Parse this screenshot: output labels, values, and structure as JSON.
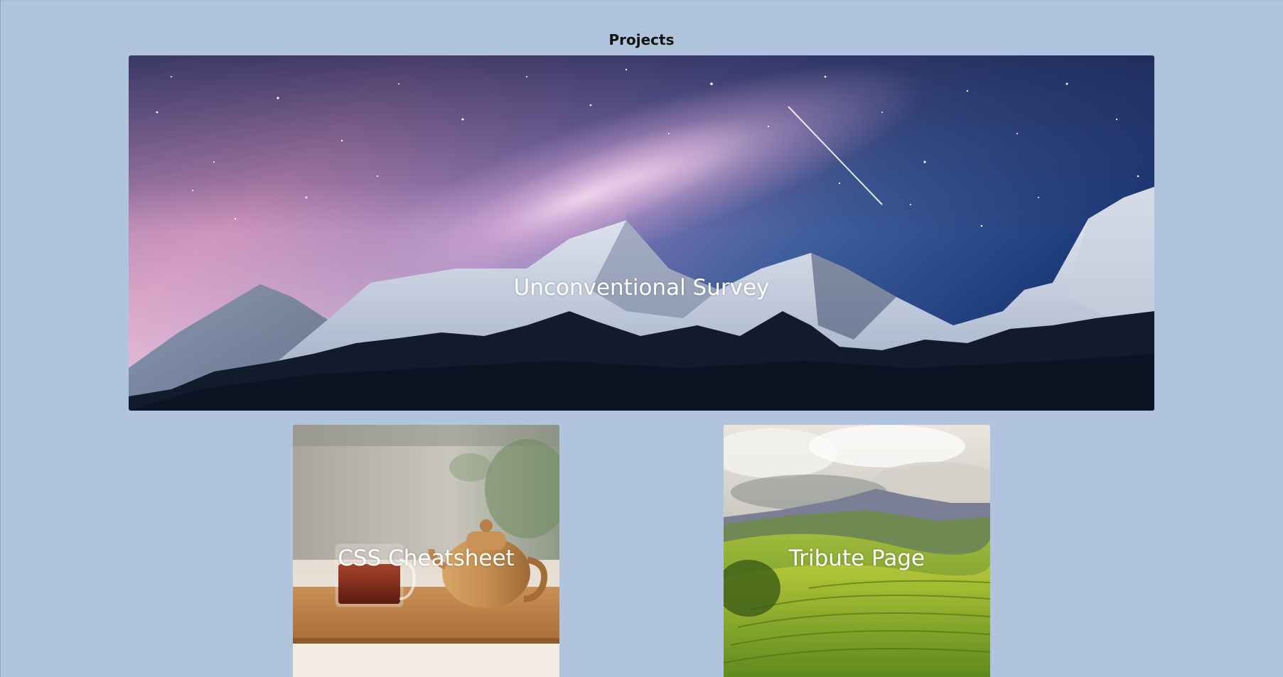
{
  "page": {
    "heading": "Projects"
  },
  "projects": [
    {
      "title": "Unconventional Survey",
      "image": "starry-mountain-night-image"
    },
    {
      "title": "CSS Cheatsheet",
      "image": "teapot-and-tea-cup-image"
    },
    {
      "title": "Tribute Page",
      "image": "tea-plantation-hills-image"
    }
  ],
  "colors": {
    "background": "#b0c4de",
    "label_text": "#ffffff",
    "heading_text": "#111111"
  }
}
